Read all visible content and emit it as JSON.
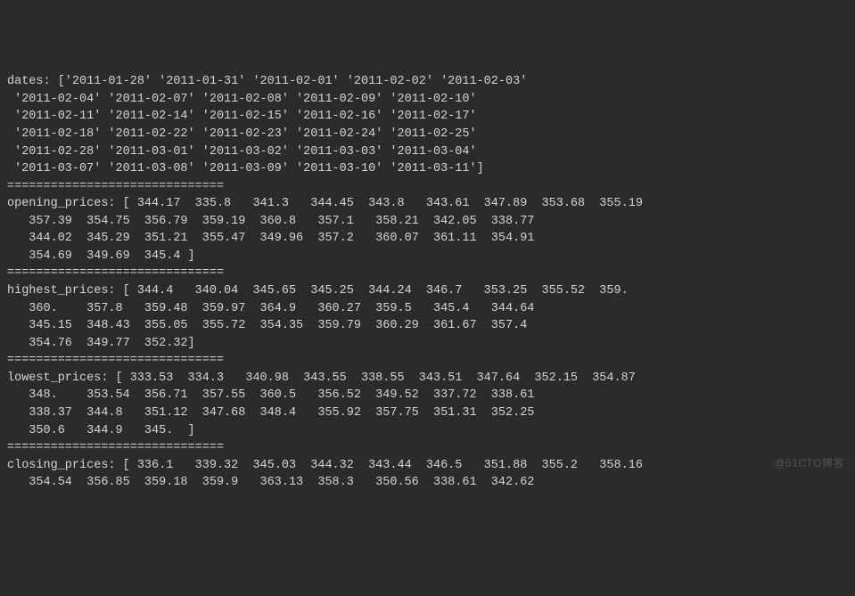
{
  "dates_label": "dates",
  "dates": [
    "2011-01-28",
    "2011-01-31",
    "2011-02-01",
    "2011-02-02",
    "2011-02-03",
    "2011-02-04",
    "2011-02-07",
    "2011-02-08",
    "2011-02-09",
    "2011-02-10",
    "2011-02-11",
    "2011-02-14",
    "2011-02-15",
    "2011-02-16",
    "2011-02-17",
    "2011-02-18",
    "2011-02-22",
    "2011-02-23",
    "2011-02-24",
    "2011-02-25",
    "2011-02-28",
    "2011-03-01",
    "2011-03-02",
    "2011-03-03",
    "2011-03-04",
    "2011-03-07",
    "2011-03-08",
    "2011-03-09",
    "2011-03-10",
    "2011-03-11"
  ],
  "separator": "==============================",
  "opening_label": "opening_prices",
  "opening_prices": [
    "344.17",
    "335.8",
    "341.3",
    "344.45",
    "343.8",
    "343.61",
    "347.89",
    "353.68",
    "355.19",
    "357.39",
    "354.75",
    "356.79",
    "359.19",
    "360.8",
    "357.1",
    "358.21",
    "342.05",
    "338.77",
    "344.02",
    "345.29",
    "351.21",
    "355.47",
    "349.96",
    "357.2",
    "360.07",
    "361.11",
    "354.91",
    "354.69",
    "349.69",
    "345.4"
  ],
  "highest_label": "highest_prices",
  "highest_prices": [
    "344.4",
    "340.04",
    "345.65",
    "345.25",
    "344.24",
    "346.7",
    "353.25",
    "355.52",
    "359.",
    "360.",
    "357.8",
    "359.48",
    "359.97",
    "364.9",
    "360.27",
    "359.5",
    "345.4",
    "344.64",
    "345.15",
    "348.43",
    "355.05",
    "355.72",
    "354.35",
    "359.79",
    "360.29",
    "361.67",
    "357.4",
    "354.76",
    "349.77",
    "352.32"
  ],
  "lowest_label": "lowest_prices",
  "lowest_prices": [
    "333.53",
    "334.3",
    "340.98",
    "343.55",
    "338.55",
    "343.51",
    "347.64",
    "352.15",
    "354.87",
    "348.",
    "353.54",
    "356.71",
    "357.55",
    "360.5",
    "356.52",
    "349.52",
    "337.72",
    "338.61",
    "338.37",
    "344.8",
    "351.12",
    "347.68",
    "348.4",
    "355.92",
    "357.75",
    "351.31",
    "352.25",
    "350.6",
    "344.9",
    "345."
  ],
  "closing_label": "closing_prices",
  "closing_prices": [
    "336.1",
    "339.32",
    "345.03",
    "344.32",
    "343.44",
    "346.5",
    "351.88",
    "355.2",
    "358.16",
    "354.54",
    "356.85",
    "359.18",
    "359.9",
    "363.13",
    "358.3",
    "350.56",
    "338.61",
    "342.62"
  ],
  "watermark": "@51CTO博客"
}
